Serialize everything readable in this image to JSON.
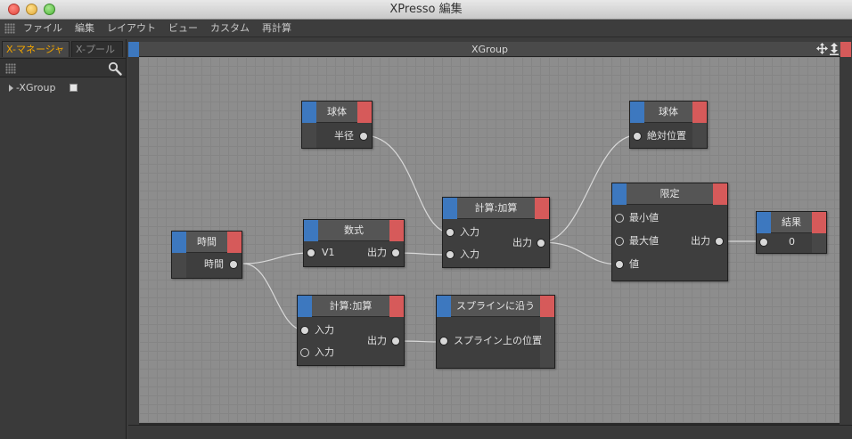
{
  "window": {
    "title": "XPresso 編集"
  },
  "menu": [
    "ファイル",
    "編集",
    "レイアウト",
    "ビュー",
    "カスタム",
    "再計算"
  ],
  "left_panel": {
    "tabs": [
      "X-マネージャ",
      "X-プール"
    ],
    "tree": [
      {
        "label": "-XGroup"
      }
    ]
  },
  "canvas": {
    "title": "XGroup",
    "nodes": {
      "sphere_radius": {
        "title": "球体",
        "port": "半径"
      },
      "sphere_position": {
        "title": "球体",
        "port": "絶対位置"
      },
      "time": {
        "title": "時間",
        "port": "時間"
      },
      "formula": {
        "title": "数式",
        "in": "V1",
        "out": "出力"
      },
      "add_top": {
        "title": "計算:加算",
        "in1": "入力",
        "in2": "入力",
        "out": "出力"
      },
      "add_bottom": {
        "title": "計算:加算",
        "in1": "入力",
        "in2": "入力",
        "out": "出力"
      },
      "spline": {
        "title": "スプラインに沿う",
        "port": "スプライン上の位置"
      },
      "clamp": {
        "title": "限定",
        "min": "最小値",
        "max": "最大値",
        "value": "値",
        "out": "出力"
      },
      "result": {
        "title": "結果",
        "value": "0"
      }
    }
  },
  "colors": {
    "accent_tab": "#f0a400",
    "node_blue": "#3d78bf",
    "node_red": "#d65a5a"
  }
}
